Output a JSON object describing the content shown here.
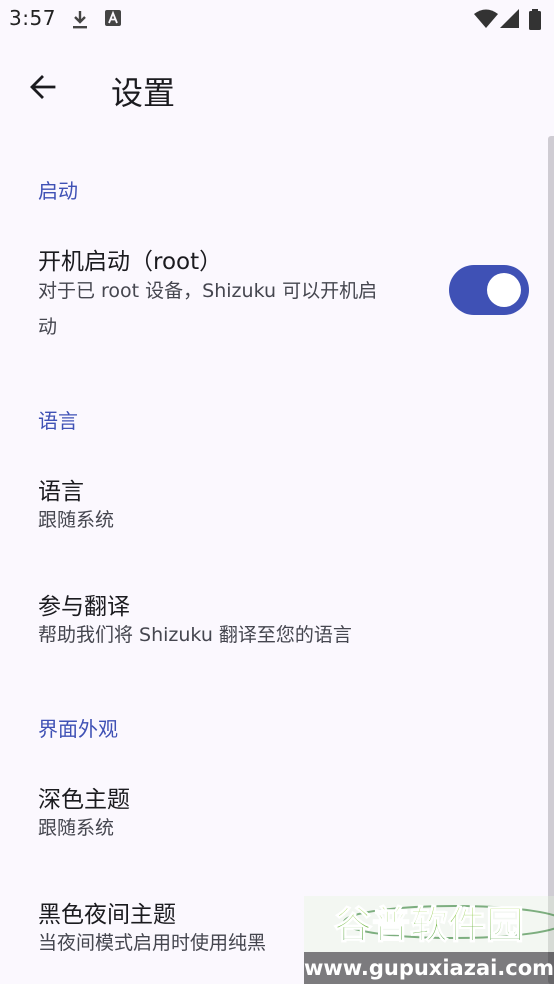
{
  "status_bar": {
    "time": "3:57",
    "icons": [
      "download-icon",
      "text-a-icon",
      "wifi-icon",
      "signal-icon",
      "battery-icon"
    ]
  },
  "app_bar": {
    "back_icon": "arrow-left-icon",
    "title": "设置"
  },
  "sections": {
    "startup": {
      "header": "启动",
      "boot_start": {
        "title": "开机启动（root）",
        "summary_line1": "对于已 root 设备，Shizuku 可以开机启",
        "summary_line2": "动",
        "switch_on": true
      }
    },
    "language": {
      "header": "语言",
      "language_item": {
        "title": "语言",
        "summary": "跟随系统"
      },
      "translate_item": {
        "title": "参与翻译",
        "summary": "帮助我们将 Shizuku 翻译至您的语言"
      }
    },
    "appearance": {
      "header": "界面外观",
      "dark_theme": {
        "title": "深色主题",
        "summary": "跟随系统"
      },
      "black_night_theme": {
        "title": "黑色夜间主题",
        "summary": "当夜间模式启用时使用纯黑"
      }
    }
  },
  "watermark": {
    "logo_text": "谷普软件园",
    "url": "www.gupuxiazai.com"
  },
  "colors": {
    "accent": "#3F51B5",
    "background": "#FBF8FE",
    "text_primary": "#1B1B1F",
    "text_secondary": "#45464F"
  }
}
